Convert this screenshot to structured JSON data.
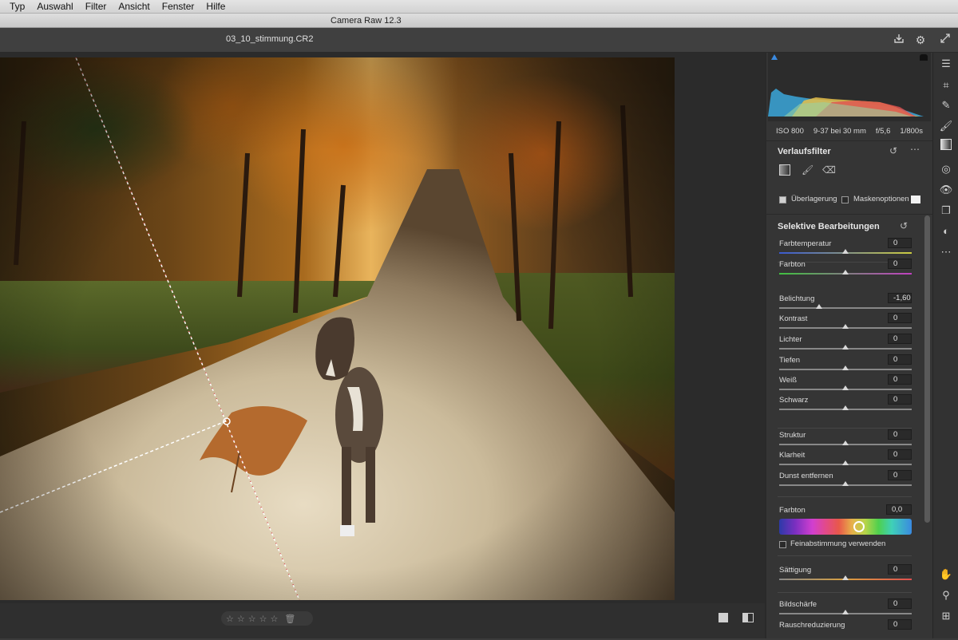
{
  "menubar": {
    "items": [
      "Typ",
      "Auswahl",
      "Filter",
      "Ansicht",
      "Fenster",
      "Hilfe"
    ]
  },
  "window": {
    "title": "Camera Raw 12.3"
  },
  "toolbar": {
    "filename": "03_10_stimmung.CR2"
  },
  "histogram": {
    "iso": "ISO 800",
    "lens": "9-37 bei 30 mm",
    "aperture": "f/5,6",
    "shutter": "1/800s"
  },
  "filter_panel": {
    "title": "Verlaufsfilter",
    "overlay_label": "Überlagerung",
    "overlay_checked": true,
    "mask_options_label": "Maskenoptionen",
    "mask_options_checked": false
  },
  "selective": {
    "title": "Selektive Bearbeitungen",
    "sliders": [
      {
        "label": "Farbtemperatur",
        "value": "0",
        "level": 0.5
      },
      {
        "label": "Farbton",
        "value": "0",
        "level": 0.5
      },
      {
        "label": "Belichtung",
        "value": "-1,60",
        "level": 0.3
      },
      {
        "label": "Kontrast",
        "value": "0",
        "level": 0.5
      },
      {
        "label": "Lichter",
        "value": "0",
        "level": 0.5
      },
      {
        "label": "Tiefen",
        "value": "0",
        "level": 0.5
      },
      {
        "label": "Weiß",
        "value": "0",
        "level": 0.5
      },
      {
        "label": "Schwarz",
        "value": "0",
        "level": 0.5
      },
      {
        "label": "Struktur",
        "value": "0",
        "level": 0.5
      },
      {
        "label": "Klarheit",
        "value": "0",
        "level": 0.5
      },
      {
        "label": "Dunst entfernen",
        "value": "0",
        "level": 0.5
      }
    ],
    "hue": {
      "label": "Farbton",
      "value": "0,0"
    },
    "fine_tune_label": "Feinabstimmung verwenden",
    "fine_tune_checked": false,
    "saturation": {
      "label": "Sättigung",
      "value": "0",
      "level": 0.5
    },
    "sharpness": {
      "label": "Bildschärfe",
      "value": "0",
      "level": 0.5
    },
    "noise": {
      "label": "Rauschreduzierung",
      "value": "0"
    }
  },
  "colors": {
    "panel_bg": "#353535",
    "canvas_bg": "#2b2b2b",
    "accent_blue": "#3a8ae0"
  },
  "rating": {
    "stars": 0,
    "max": 5
  }
}
